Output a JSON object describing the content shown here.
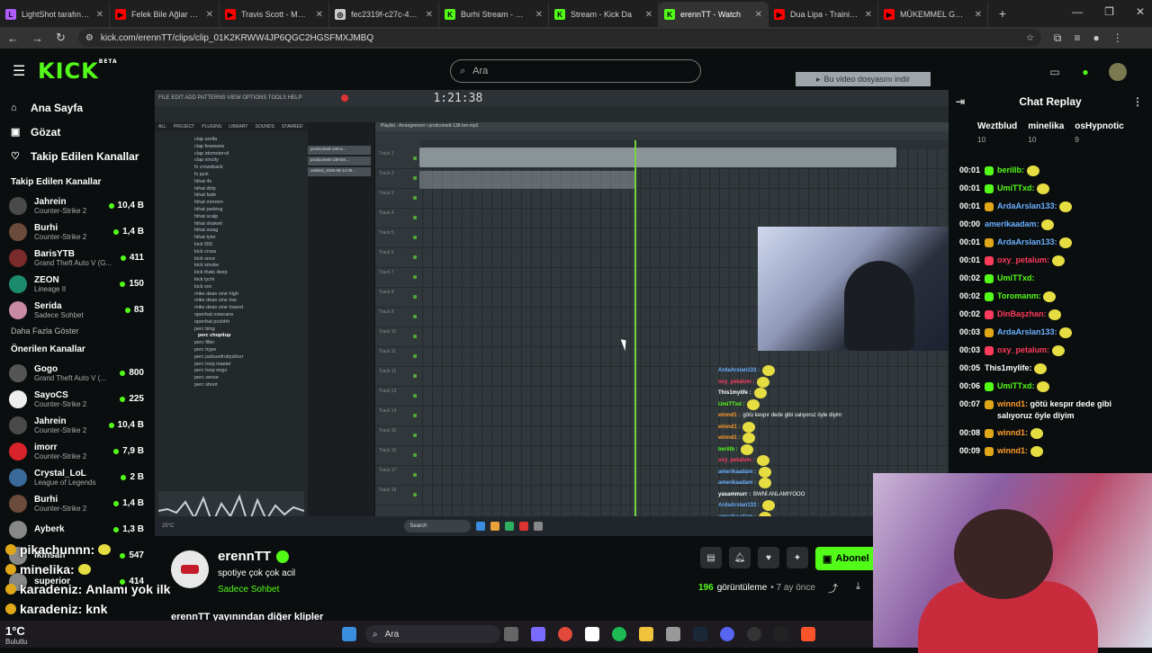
{
  "browser": {
    "tabs": [
      {
        "title": "LightShot tarafından",
        "color": "#b15cff",
        "icon": "L"
      },
      {
        "title": "Felek Bile Ağlar Oldu",
        "color": "#ff0000",
        "icon": "▶"
      },
      {
        "title": "Travis Scott - MO CIT",
        "color": "#ff0000",
        "icon": "▶"
      },
      {
        "title": "fec2319f-c27c-4801-",
        "color": "#cccccc",
        "icon": "◎"
      },
      {
        "title": "Burhi Stream - Watch",
        "color": "#53fc18",
        "icon": "K"
      },
      {
        "title": "Stream - Kick Da",
        "color": "#53fc18",
        "icon": "K"
      },
      {
        "title": "erennTT - Watch",
        "color": "#53fc18",
        "icon": "K",
        "active": true
      },
      {
        "title": "Dua Lipa - Training S",
        "color": "#ff0000",
        "icon": "▶"
      },
      {
        "title": "MÜKEMMEL GRAFİK",
        "color": "#ff0000",
        "icon": "▶"
      }
    ],
    "url": "kick.com/erennTT/clips/clip_01K2KRWW4JP6QGC2HGSFMXJMBQ"
  },
  "header": {
    "logo": "KICK",
    "logo_sup": "BETA",
    "search_placeholder": "Ara"
  },
  "sidebar": {
    "nav": [
      {
        "label": "Ana Sayfa",
        "icon": "⌂"
      },
      {
        "label": "Gözat",
        "icon": "▣"
      },
      {
        "label": "Takip Edilen Kanallar",
        "icon": "♡"
      }
    ],
    "followed_title": "Takip Edilen Kanallar",
    "followed": [
      {
        "name": "Jahrein",
        "game": "Counter-Strike 2",
        "viewers": "10,4 B",
        "color": "#4a4a4a"
      },
      {
        "name": "Burhi",
        "game": "Counter-Strike 2",
        "viewers": "1,4 B",
        "color": "#6b4b3a"
      },
      {
        "name": "BarisYTB",
        "game": "Grand Theft Auto V (G...",
        "viewers": "411",
        "color": "#7a2a2a"
      },
      {
        "name": "ZEON",
        "game": "Lineage II",
        "viewers": "150",
        "color": "#1c8a6c"
      },
      {
        "name": "Serida",
        "game": "Sadece Sohbet",
        "viewers": "83",
        "color": "#c98aa2"
      }
    ],
    "show_more": "Daha Fazla Göster",
    "recommended_title": "Önerilen Kanallar",
    "recommended": [
      {
        "name": "Gogo",
        "game": "Grand Theft Auto V (...",
        "viewers": "800",
        "color": "#555"
      },
      {
        "name": "SayoCS",
        "game": "Counter-Strike 2",
        "viewers": "225",
        "color": "#eee"
      },
      {
        "name": "Jahrein",
        "game": "Counter-Strike 2",
        "viewers": "10,4 B",
        "color": "#4a4a4a"
      },
      {
        "name": "imorr",
        "game": "Counter-Strike 2",
        "viewers": "7,9 B",
        "color": "#d8232a"
      },
      {
        "name": "Crystal_LoL",
        "game": "League of Legends",
        "viewers": "2 B",
        "color": "#3a6a9a"
      },
      {
        "name": "Burhi",
        "game": "Counter-Strike 2",
        "viewers": "1,4 B",
        "color": "#6b4b3a"
      },
      {
        "name": "Ayberk",
        "game": "",
        "viewers": "1,3 B",
        "color": "#888"
      },
      {
        "name": "ikinsan",
        "game": "",
        "viewers": "547",
        "color": "#888"
      },
      {
        "name": "superior",
        "game": "",
        "viewers": "414",
        "color": "#888"
      }
    ]
  },
  "video": {
    "download_label": "Bu video dosyasını indir",
    "fl_time": "1:21:38",
    "browser_items": [
      "clap arolla",
      "clap fewwane",
      "clap idomotorvil",
      "clap sincity",
      "fx crowsback",
      "fx jack",
      "hihat 4s",
      "hihat dirty",
      "hihat fade",
      "hihat mmmm",
      "hihat parking",
      "hihat scalp",
      "hihat shakeit",
      "hihat swag",
      "hihat tyler",
      "kick 555",
      "kick cross",
      "kick once",
      "kick smoke",
      "kick thats deep",
      "kick tychi",
      "kick xxx",
      "mike dean sine high",
      "mike dean sine low",
      "mike dean sine lowest",
      "openhat nowcane",
      "openhat pcshhh",
      "perc bing",
      "perc chopitup",
      "perc filler",
      "perc hype",
      "perc justusefruityslicer",
      "perc loop master",
      "perc loop ongo",
      "perc sense",
      "perc shoot"
    ],
    "channel_rack": [
      "prodcomett-140-a...",
      "prodcomett-138-bm...",
      "untitled_2025-08-14 00..."
    ],
    "playlist_title": "Playlist - Arrangement • prodcomett-138-bm-mp3",
    "tracks": [
      "Track 1",
      "Track 2",
      "Track 3",
      "Track 4",
      "Track 5",
      "Track 6",
      "Track 7",
      "Track 8",
      "Track 9",
      "Track 10",
      "Track 11",
      "Track 12",
      "Track 13",
      "Track 14",
      "Track 15",
      "Track 16",
      "Track 17",
      "Track 18"
    ],
    "taskbar_search": "Search",
    "chat": [
      {
        "user": "ArdaArslan133 :",
        "color": "#6ab0ff",
        "text": ""
      },
      {
        "user": "oxy_petalum :",
        "color": "#ff3b5c",
        "text": ""
      },
      {
        "user": "This1mylife :",
        "color": "#ffffff",
        "text": ""
      },
      {
        "user": "UmiTTxd :",
        "color": "#53fc18",
        "text": ""
      },
      {
        "user": "winnd1 :",
        "color": "#ff9c2a",
        "text": "götü kespır dede gibi salıyoruz öyle diyim"
      },
      {
        "user": "winnd1 :",
        "color": "#ff9c2a",
        "text": ""
      },
      {
        "user": "winnd1 :",
        "color": "#ff9c2a",
        "text": ""
      },
      {
        "user": "berillb :",
        "color": "#53fc18",
        "text": ""
      },
      {
        "user": "oxy_petalum :",
        "color": "#ff3b5c",
        "text": ""
      },
      {
        "user": "amerikaadam :",
        "color": "#6ab0ff",
        "text": ""
      },
      {
        "user": "amerikaadam :",
        "color": "#6ab0ff",
        "text": ""
      },
      {
        "user": "yasammurr :",
        "color": "#ffffff",
        "text": "BWNİ ANLAMIYOOO"
      },
      {
        "user": "ArdaArslan133 :",
        "color": "#6ab0ff",
        "text": ""
      },
      {
        "user": "amerikaadam :",
        "color": "#6ab0ff",
        "text": ""
      }
    ]
  },
  "chat": {
    "title": "Chat Replay",
    "leaders": [
      {
        "name": "Weztblud",
        "count": "10"
      },
      {
        "name": "minelika",
        "count": "10"
      },
      {
        "name": "osHypnotic",
        "count": "9"
      }
    ],
    "messages": [
      {
        "ts": "00:01",
        "user": "berillb:",
        "color": "#53fc18",
        "text": "",
        "emote": true,
        "badge": "#53fc18"
      },
      {
        "ts": "00:01",
        "user": "UmiTTxd:",
        "color": "#53fc18",
        "text": "",
        "emote": true,
        "badge": "#53fc18"
      },
      {
        "ts": "00:01",
        "user": "ArdaArslan133:",
        "color": "#6ab0ff",
        "text": "",
        "emote": true,
        "badge": "#e0a818"
      },
      {
        "ts": "00:00",
        "user": "amerikaadam:",
        "color": "#6ab0ff",
        "text": "",
        "emote": true,
        "badge": ""
      },
      {
        "ts": "00:01",
        "user": "ArdaArslan133:",
        "color": "#6ab0ff",
        "text": "",
        "emote": true,
        "badge": "#e0a818"
      },
      {
        "ts": "00:01",
        "user": "oxy_petalum:",
        "color": "#ff3b5c",
        "text": "",
        "emote": true,
        "badge": "#ff3b5c"
      },
      {
        "ts": "00:02",
        "user": "UmiTTxd:",
        "color": "#53fc18",
        "text": "",
        "emote": false,
        "badge": "#53fc18"
      },
      {
        "ts": "00:02",
        "user": "Toromanm:",
        "color": "#53fc18",
        "text": "",
        "emote": true,
        "badge": "#53fc18"
      },
      {
        "ts": "00:02",
        "user": "DinBaşzhan:",
        "color": "#ff3b5c",
        "text": "",
        "emote": true,
        "badge": "#ff3b5c"
      },
      {
        "ts": "00:03",
        "user": "ArdaArslan133:",
        "color": "#6ab0ff",
        "text": "",
        "emote": true,
        "badge": "#e0a818"
      },
      {
        "ts": "00:03",
        "user": "oxy_petalum:",
        "color": "#ff3b5c",
        "text": "",
        "emote": true,
        "badge": "#ff3b5c"
      },
      {
        "ts": "00:05",
        "user": "This1mylife:",
        "color": "#ffffff",
        "text": "",
        "emote": true,
        "badge": ""
      },
      {
        "ts": "00:06",
        "user": "UmiTTxd:",
        "color": "#53fc18",
        "text": "",
        "emote": true,
        "badge": "#53fc18"
      },
      {
        "ts": "00:07",
        "user": "winnd1:",
        "color": "#ff9c2a",
        "text": "götü kespır dede gibi salıyoruz öyle diyim",
        "emote": false,
        "badge": "#e0a818"
      },
      {
        "ts": "00:08",
        "user": "winnd1:",
        "color": "#ff9c2a",
        "text": "",
        "emote": true,
        "badge": "#e0a818"
      },
      {
        "ts": "00:09",
        "user": "winnd1:",
        "color": "#ff9c2a",
        "text": "",
        "emote": true,
        "badge": "#e0a818"
      }
    ]
  },
  "channel": {
    "name": "erennTT",
    "title": "spotiye çok çok acil",
    "category": "Sadece Sohbet",
    "subscribe": "Abonel",
    "views": "196",
    "views_label": "görüntüleme",
    "ago": "• 7 ay önce",
    "more_clips": "erennTT yayınından diğer klipler"
  },
  "overlay_chat": [
    {
      "user": "pikachunnn:",
      "text": ""
    },
    {
      "user": "minelika:",
      "text": ""
    },
    {
      "user": "karadeniz:",
      "text": "Anlamı yok ilk"
    },
    {
      "user": "karadeniz:",
      "text": "knk"
    }
  ],
  "taskbar": {
    "search": "Ara",
    "weather": "Bulutlu",
    "temp": "1°C"
  }
}
